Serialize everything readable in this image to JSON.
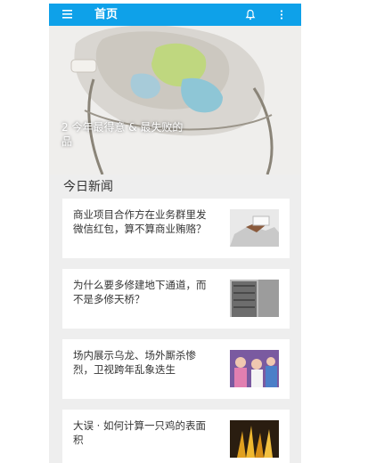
{
  "topbar": {
    "title": "首页",
    "menu_icon": "menu-icon",
    "bell_icon": "bell-icon",
    "more_icon": "more-vertical-icon"
  },
  "banner": {
    "caption_line1": "2 今年最得意 & 最失败的",
    "caption_line2": "品",
    "slides": 4
  },
  "section": {
    "title": "今日新闻"
  },
  "news": [
    {
      "title": "商业项目合作方在业务群里发微信红包，算不算商业贿赂？"
    },
    {
      "title": "为什么要多修建地下通道，而不是多修天桥？"
    },
    {
      "title": "场内展示乌龙、场外厮杀惨烈，卫视跨年乱象迭生"
    },
    {
      "title": "大误 · 如何计算一只鸡的表面积"
    }
  ],
  "colors": {
    "accent": "#0ea1e9",
    "background": "#eeeeee"
  }
}
